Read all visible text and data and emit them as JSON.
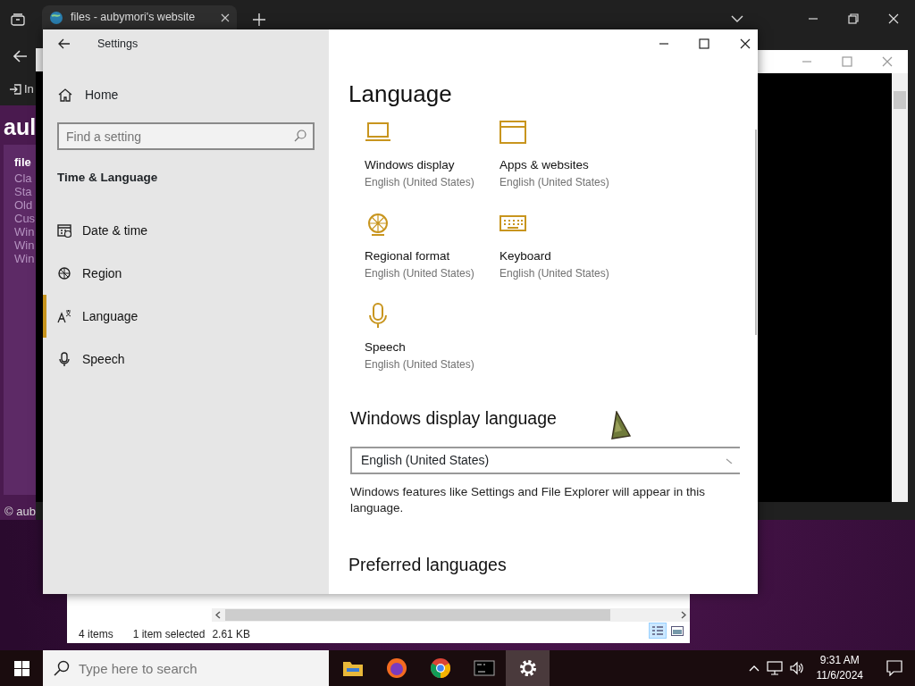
{
  "browser": {
    "tabs": [
      {
        "label": "files - aubymori's website",
        "selected": true
      }
    ],
    "toolbar_label": "In",
    "page": {
      "heading": "aul",
      "sidebar_title": "file",
      "links": [
        "Cla",
        "Sta",
        "Old",
        "Cus",
        "Win",
        "Win",
        "Win"
      ],
      "footer": "© aub"
    }
  },
  "settings": {
    "title": "Settings",
    "home": "Home",
    "search_placeholder": "Find a setting",
    "section": "Time & Language",
    "nav": [
      {
        "label": "Date & time",
        "kind": "calendar",
        "selected": false
      },
      {
        "label": "Region",
        "kind": "globe",
        "selected": false
      },
      {
        "label": "Language",
        "kind": "language",
        "selected": true
      },
      {
        "label": "Speech",
        "kind": "microphone",
        "selected": false
      }
    ],
    "heading": "Language",
    "tiles": [
      {
        "kind": "laptop",
        "title": "Windows display",
        "subtitle": "English (United States)"
      },
      {
        "kind": "window",
        "title": "Apps & websites",
        "subtitle": "English (United States)"
      },
      {
        "kind": "globe",
        "title": "Regional format",
        "subtitle": "English (United States)"
      },
      {
        "kind": "keyboard",
        "title": "Keyboard",
        "subtitle": "English (United States)"
      },
      {
        "kind": "microphone",
        "title": "Speech",
        "subtitle": "English (United States)"
      }
    ],
    "display_language_heading": "Windows display language",
    "display_language_value": "English (United States)",
    "description": "Windows features like Settings and File Explorer will appear in this language.",
    "preferred_heading": "Preferred languages"
  },
  "explorer": {
    "item_count": "4 items",
    "selection": "1 item selected",
    "size": "2.61 KB",
    "views": [
      {
        "kind": "details",
        "selected": true
      },
      {
        "kind": "preview",
        "selected": false
      }
    ]
  },
  "taskbar": {
    "search_placeholder": "Type here to search",
    "apps": [
      {
        "kind": "folder",
        "selected": false
      },
      {
        "kind": "firefox",
        "selected": false
      },
      {
        "kind": "chrome",
        "selected": false
      },
      {
        "kind": "terminal",
        "selected": false
      },
      {
        "kind": "gear",
        "selected": true
      }
    ],
    "time": "9:31 AM",
    "date": "11/6/2024"
  }
}
